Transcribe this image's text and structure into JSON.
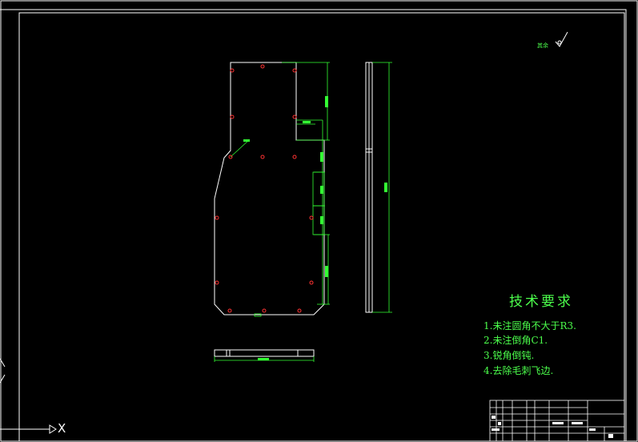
{
  "colors": {
    "background": "#000000",
    "frame": "#ffffff",
    "dimension": "#33ff33",
    "hole": "#ff3333",
    "text": "#4cff4c"
  },
  "technical_requirements": {
    "title": "技术要求",
    "items": [
      "1.未注圆角不大于R3.",
      "2.未注倒角C1.",
      "3.锐角倒钝.",
      "4.去除毛刺飞边."
    ]
  },
  "axis": {
    "x_label": "X"
  },
  "roughness_symbol": {
    "label": "其余"
  }
}
